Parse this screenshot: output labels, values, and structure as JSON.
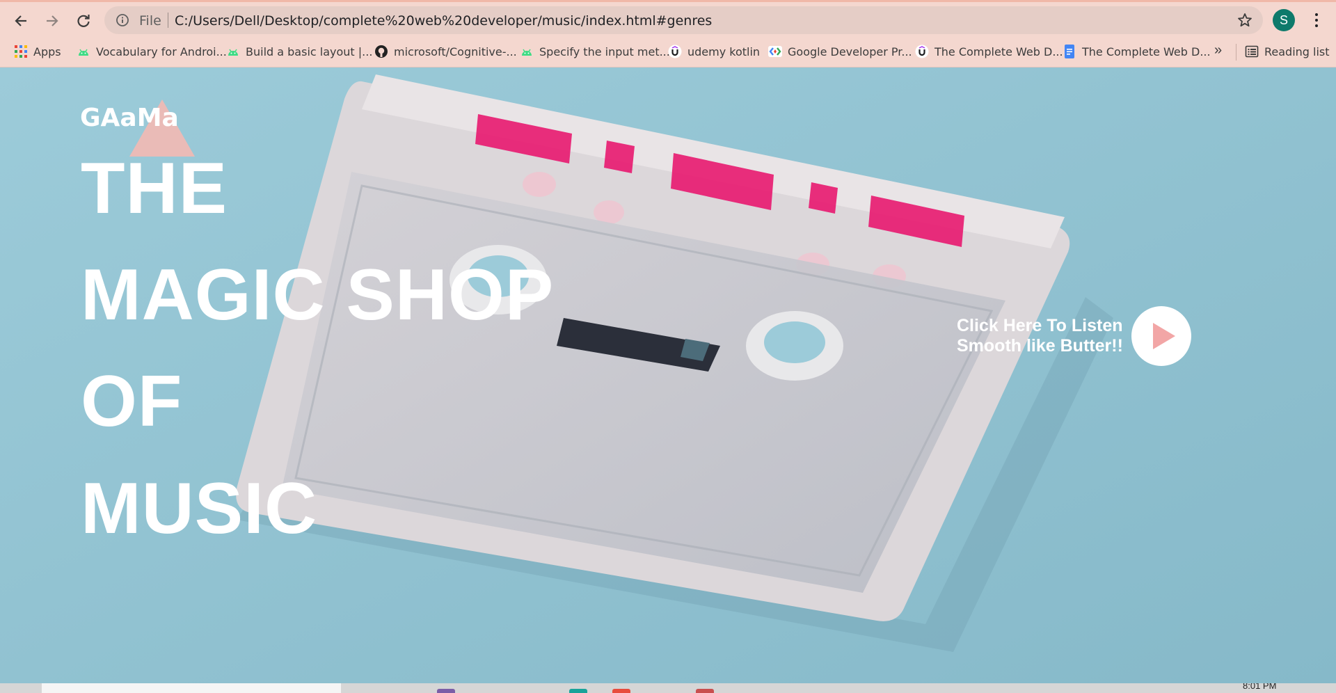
{
  "browser": {
    "omnibox": {
      "scheme_label": "File",
      "url": "C:/Users/Dell/Desktop/complete%20web%20developer/music/index.html#genres"
    },
    "profile_initial": "S",
    "bookmarks": [
      {
        "label": "Apps",
        "icon": "apps-grid-icon"
      },
      {
        "label": "Vocabulary for Androi...",
        "icon": "android-icon"
      },
      {
        "label": "Build a basic layout |...",
        "icon": "android-icon"
      },
      {
        "label": "microsoft/Cognitive-...",
        "icon": "github-icon"
      },
      {
        "label": "Specify the input met...",
        "icon": "android-icon"
      },
      {
        "label": "udemy kotlin",
        "icon": "udemy-icon"
      },
      {
        "label": "Google Developer Pr...",
        "icon": "google-developers-icon"
      },
      {
        "label": "The Complete Web D...",
        "icon": "udemy-icon"
      },
      {
        "label": "The Complete Web D...",
        "icon": "google-docs-icon"
      }
    ],
    "more_bookmarks": "»",
    "reading_list": "Reading list"
  },
  "site": {
    "logo": "GAaMa",
    "headline": [
      "THE",
      "MAGIC SHOP",
      "OF",
      "MUSIC"
    ],
    "listen_line1": "Click Here To Listen",
    "listen_line2": "Smooth like Butter!!"
  },
  "taskbar": {
    "clock": "8:01 PM"
  },
  "colors": {
    "chrome_bg": "#f4d7cf",
    "page_bg": "#93c2d1",
    "accent_pink": "#e8186f",
    "logo_triangle": "#f3b9b4",
    "play_icon": "#f2a6a6"
  }
}
